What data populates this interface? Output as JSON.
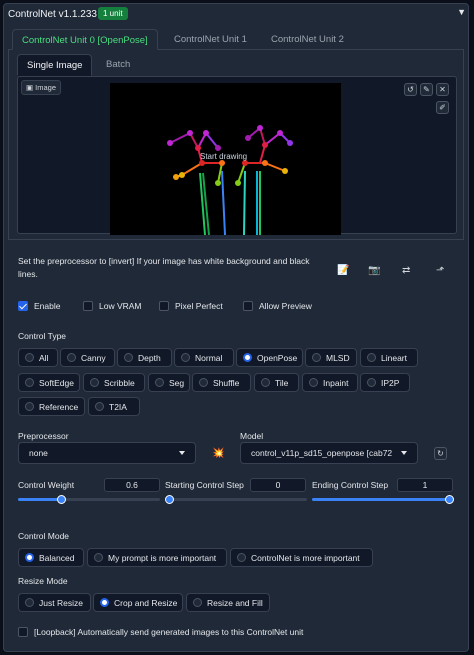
{
  "panel": {
    "title": "ControlNet v1.1.233",
    "badge": "1 unit",
    "collapse_icon": "triangle-down-icon"
  },
  "units": {
    "tabs": [
      "ControlNet Unit 0 [OpenPose]",
      "ControlNet Unit 1",
      "ControlNet Unit 2"
    ],
    "active": 0
  },
  "image_tabs": {
    "tabs": [
      "Single Image",
      "Batch"
    ],
    "active": 0
  },
  "image": {
    "label": "Image",
    "overlay": "Start drawing",
    "tools": [
      "undo-icon",
      "edit-icon",
      "close-icon",
      "brush-icon"
    ]
  },
  "hint": "Set the preprocessor to [invert] If your image has white background and black lines.",
  "image_tools": [
    "edit-icon",
    "camera-icon",
    "swap-icon",
    "upload-icon"
  ],
  "options": [
    {
      "label": "Enable",
      "checked": true
    },
    {
      "label": "Low VRAM",
      "checked": false
    },
    {
      "label": "Pixel Perfect",
      "checked": false
    },
    {
      "label": "Allow Preview",
      "checked": false
    }
  ],
  "control_type": {
    "label": "Control Type",
    "options": [
      "All",
      "Canny",
      "Depth",
      "Normal",
      "OpenPose",
      "MLSD",
      "Lineart",
      "SoftEdge",
      "Scribble",
      "Seg",
      "Shuffle",
      "Tile",
      "Inpaint",
      "IP2P",
      "Reference",
      "T2IA"
    ],
    "selected": "OpenPose"
  },
  "preprocessor": {
    "label": "Preprocessor",
    "value": "none"
  },
  "run_icon": "explosion-icon",
  "model": {
    "label": "Model",
    "value": "control_v11p_sd15_openpose [cab72",
    "refresh_icon": "refresh-icon"
  },
  "sliders": [
    {
      "label": "Control Weight",
      "value": "0.6",
      "fraction": 0.3
    },
    {
      "label": "Starting Control Step",
      "value": "0",
      "fraction": 0.0
    },
    {
      "label": "Ending Control Step",
      "value": "1",
      "fraction": 1.0
    }
  ],
  "control_mode": {
    "label": "Control Mode",
    "options": [
      "Balanced",
      "My prompt is more important",
      "ControlNet is more important"
    ],
    "selected": "Balanced"
  },
  "resize_mode": {
    "label": "Resize Mode",
    "options": [
      "Just Resize",
      "Crop and Resize",
      "Resize and Fill"
    ],
    "selected": "Crop and Resize"
  },
  "loopback": {
    "label": "[Loopback] Automatically send generated images to this ControlNet unit",
    "checked": false
  },
  "colors": {
    "accent": "#2563eb",
    "active_tab": "#4ade80",
    "badge": "#15803d",
    "panel": "#1f2937"
  }
}
